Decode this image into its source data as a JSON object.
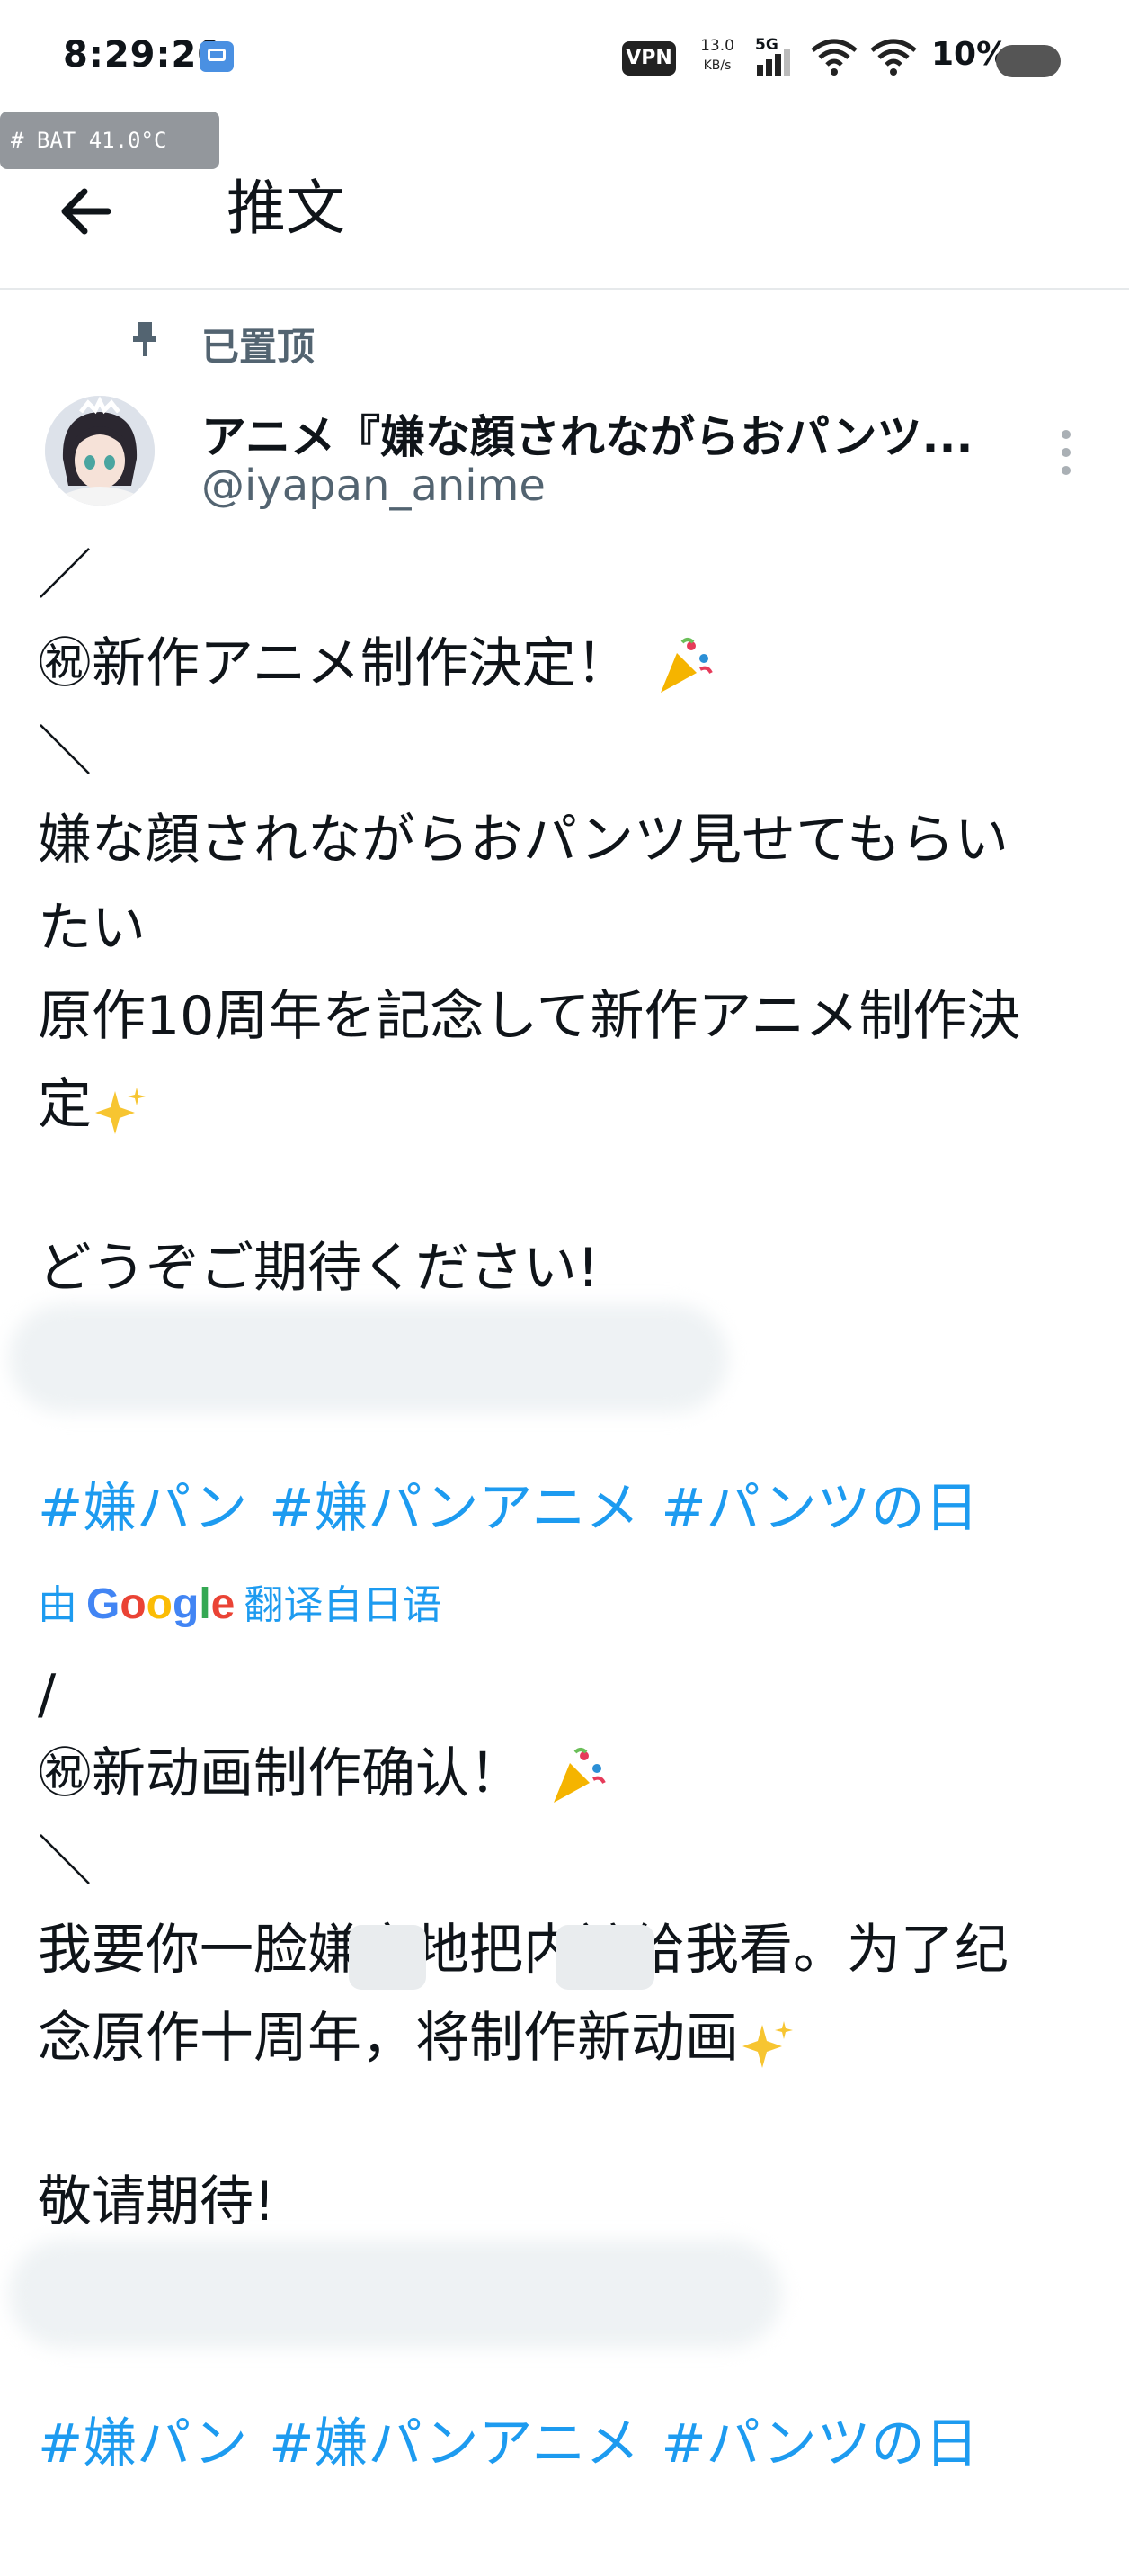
{
  "status_bar": {
    "time": "8:29:20",
    "vpn": "VPN",
    "net_speed_value": "13.0",
    "net_speed_unit": "KB/s",
    "network_type": "5G",
    "battery_percent": "10%",
    "temp_tag": "# BAT 41.0°C"
  },
  "header": {
    "title": "推文"
  },
  "tweet": {
    "pinned_label": "已置顶",
    "display_name": "アニメ『嫌な顔されながらおパンツ...",
    "handle": "@iyapan_anime",
    "original_lines": [
      "／",
      "㊗新作アニメ制作決定！",
      "＼",
      "嫌な顔されながらおパンツ見せてもらい",
      "たい",
      "原作10周年を記念して新作アニメ制作決",
      "定",
      "どうぞご期待ください!"
    ],
    "hashtags": [
      "#嫌パン",
      "#嫌パンアニメ",
      "#パンツの日"
    ],
    "translate": {
      "prefix": "由",
      "brand": "Google",
      "suffix": "翻译自日语"
    },
    "translated_lines": [
      "/",
      "㊗新动画制作确认！",
      "＼",
      "我要你一脸嫌弃地把内裤给我看。为了纪",
      "念原作十周年，将制作新动画",
      "敬请期待!"
    ],
    "translated_hashtags": [
      "#嫌パン",
      "#嫌パンアニメ",
      "#パンツの日"
    ]
  }
}
